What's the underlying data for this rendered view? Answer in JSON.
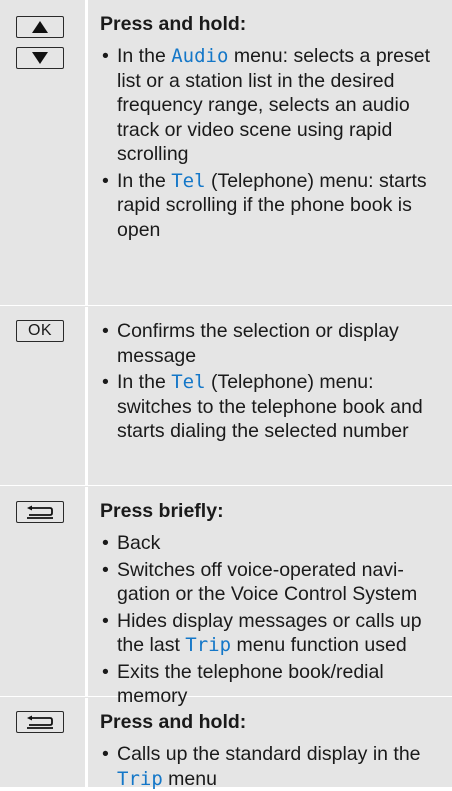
{
  "rows": [
    {
      "keys": [
        {
          "icon": "up-arrow-icon"
        },
        {
          "icon": "down-arrow-icon"
        }
      ],
      "heading": "Press and hold:",
      "bullets": [
        {
          "before": "In the ",
          "highlight": "Audio",
          "after": " menu: selects a pre­set list or a station list in the desired frequency range, selects an audio track or video scene using rapid scrolling"
        },
        {
          "before": "In the ",
          "highlight": "Tel",
          "after": " (Telephone) menu: starts rapid scrolling if the phone book is open"
        }
      ]
    },
    {
      "keys": [
        {
          "icon": "ok-icon",
          "label": "OK"
        }
      ],
      "heading": "",
      "bullets": [
        {
          "before": "Confirms the selection or display message",
          "highlight": "",
          "after": ""
        },
        {
          "before": "In the ",
          "highlight": "Tel",
          "after": " (Telephone) menu: switches to the telephone book and starts dialing the selected number"
        }
      ]
    },
    {
      "keys": [
        {
          "icon": "back-icon"
        }
      ],
      "heading": "Press briefly:",
      "bullets": [
        {
          "before": "Back",
          "highlight": "",
          "after": ""
        },
        {
          "before": "Switches off voice-operated navi­gation or the Voice Control System",
          "highlight": "",
          "after": ""
        },
        {
          "before": "Hides display messages or calls up the last ",
          "highlight": "Trip",
          "after": " menu function used"
        },
        {
          "before": "Exits the telephone book/redial memory",
          "highlight": "",
          "after": ""
        }
      ]
    },
    {
      "keys": [
        {
          "icon": "back-icon"
        }
      ],
      "heading": "Press and hold:",
      "bullets": [
        {
          "before": "Calls up the standard display in the ",
          "highlight": "Trip",
          "after": " menu"
        }
      ]
    }
  ],
  "colors": {
    "background": "#e5e5e5",
    "highlight": "#1477c8",
    "divider": "#ffffff"
  }
}
